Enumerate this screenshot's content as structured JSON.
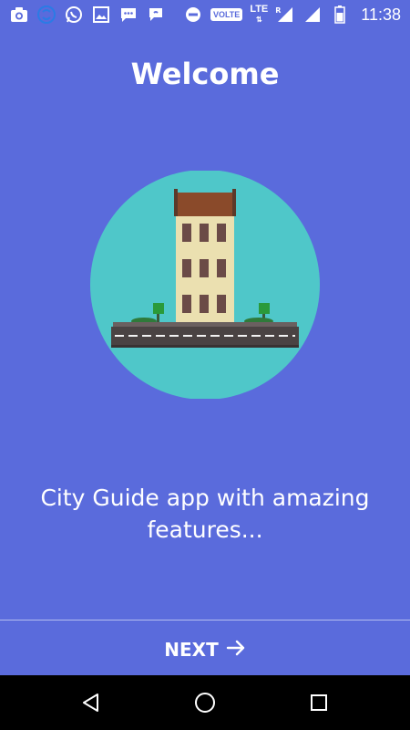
{
  "status_bar": {
    "time": "11:38",
    "volte": "VOLTE",
    "lte": "LTE",
    "roaming": "R",
    "left_icons": [
      "camera-icon",
      "sync-icon",
      "whatsapp-icon",
      "gallery-icon",
      "message-icon",
      "chat-icon"
    ],
    "right_icons": [
      "do-not-disturb-icon",
      "volte-icon",
      "lte-icon",
      "signal-icon",
      "signal-icon",
      "battery-icon"
    ]
  },
  "onboarding": {
    "title": "Welcome",
    "subtitle": "City Guide app with amazing features...",
    "next_label": "NEXT"
  },
  "nav_bar": {
    "buttons": [
      "back-icon",
      "home-icon",
      "recents-icon"
    ]
  },
  "colors": {
    "background": "#5a6bdc",
    "circle": "#4fc7c9",
    "building": "#ebe0b0",
    "roof": "#8a4a2a",
    "windows": "#6b4b47",
    "road": "#4a4343"
  }
}
